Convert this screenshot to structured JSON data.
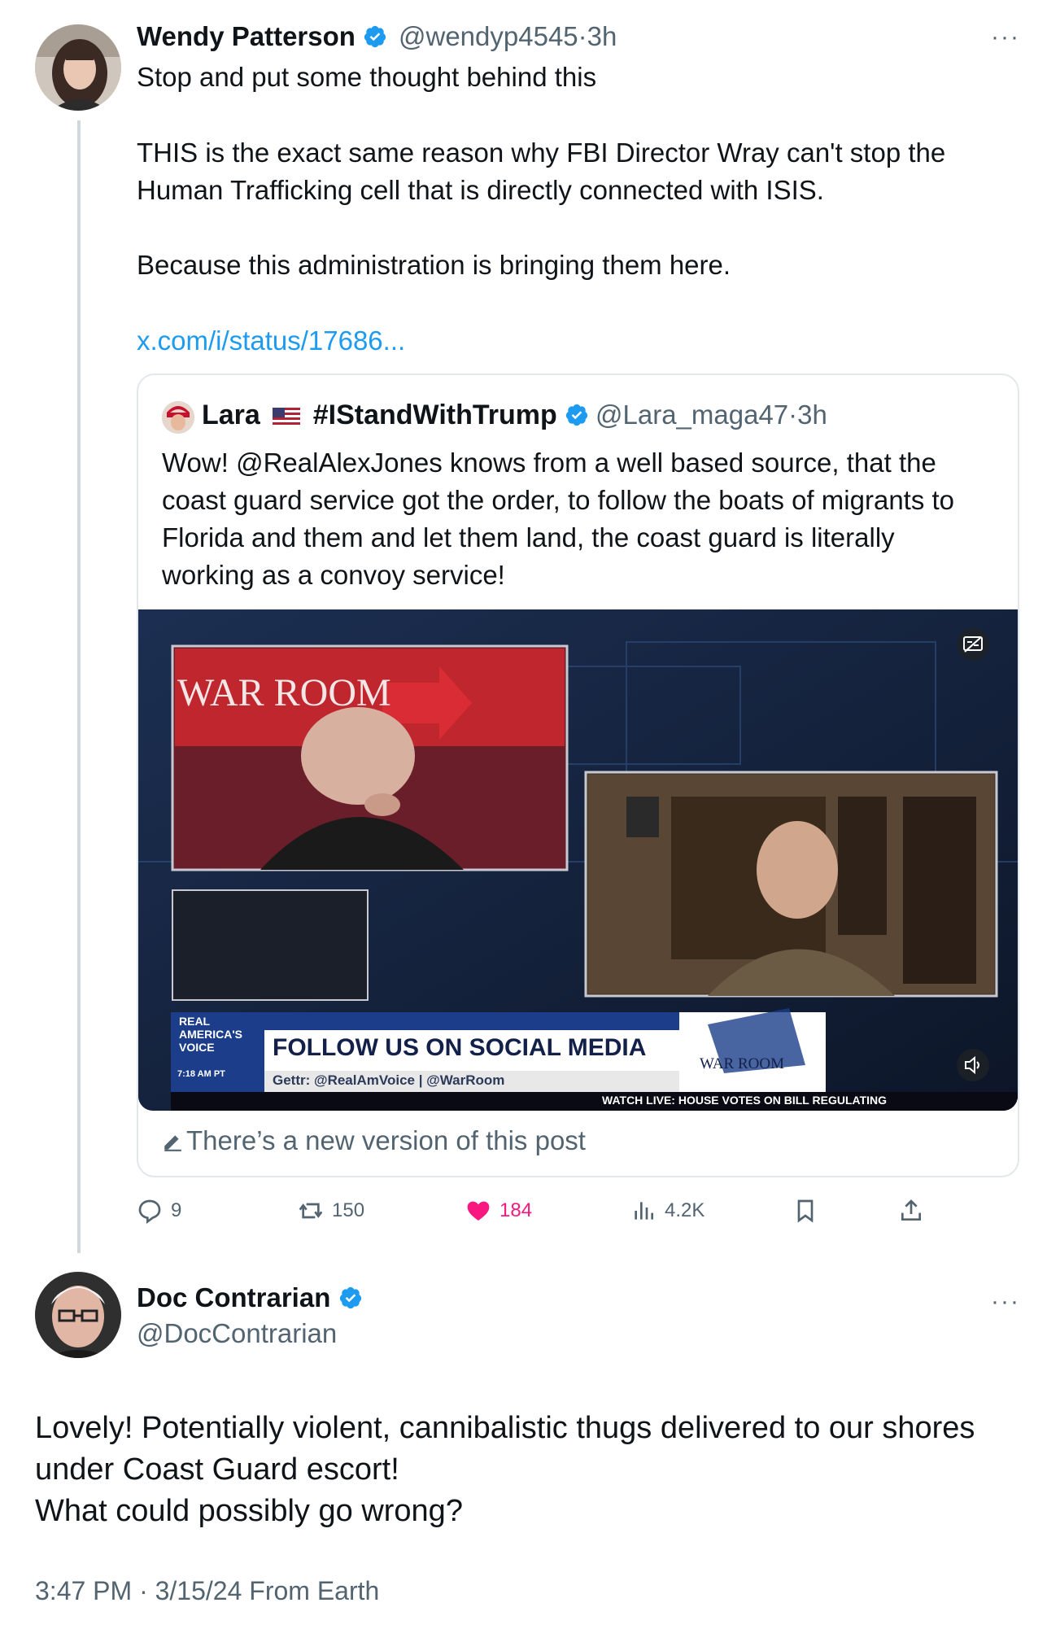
{
  "tweet1": {
    "author_name": "Wendy Patterson",
    "handle": "@wendyp4545",
    "separator": "·",
    "time": "3h",
    "lines": [
      "Stop and put some thought behind this",
      "THIS is the exact same reason why FBI Director Wray can't stop the",
      "Human Trafficking cell that is directly connected with ISIS.",
      "Because this administration is bringing them here."
    ],
    "link": "x.com/i/status/17686...",
    "more_icon": "more-dots-icon",
    "verified_color": "#1d9bf0"
  },
  "quote": {
    "author_name": "Lara",
    "hashtag_name": "#IStandWithTrump",
    "handle": "@Lara_maga47",
    "separator": "·",
    "time": "3h",
    "lines": [
      "Wow! @RealAlexJones knows from a well based source, that the",
      "coast guard service got the order,  to follow the boats of migrants to",
      "Florida and them and let them land, the coast guard is literally",
      "working as a convoy service!"
    ],
    "video": {
      "war_room_title": "WAR ROOM",
      "network_logo": "REAL AMERICA'S VOICE",
      "clock": "7:18 AM PT",
      "headline": "FOLLOW US ON SOCIAL MEDIA",
      "subline": "Gettr: @RealAmVoice | @WarRoom",
      "ticker": "WATCH LIVE: HOUSE VOTES ON BILL REGULATING",
      "corner_logo": "WAR ROOM"
    },
    "new_version_text": "There’s a new version of this post"
  },
  "actions": {
    "replies": "9",
    "reposts": "150",
    "likes": "184",
    "views": "4.2K",
    "like_color": "#f91880"
  },
  "tweet2": {
    "author_name": "Doc Contrarian",
    "handle": "@DocContrarian",
    "lines": [
      "Lovely! Potentially violent, cannibalistic thugs delivered to our shores",
      "under Coast Guard escort!",
      "What could possibly go wrong?"
    ],
    "timestamp": "3:47 PM · 3/15/24 From Earth"
  }
}
